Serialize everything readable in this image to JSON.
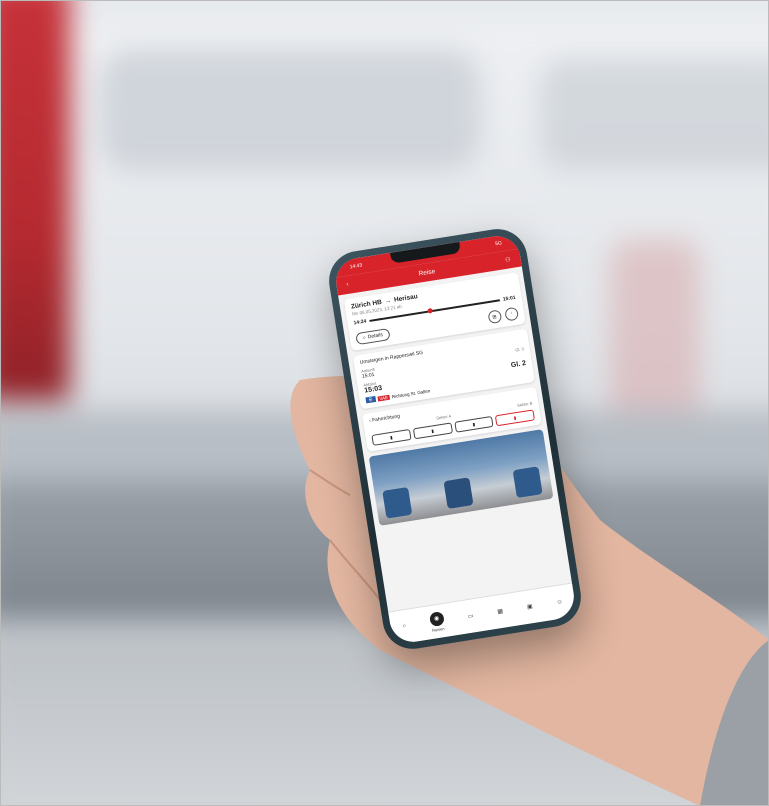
{
  "status": {
    "time": "14:43",
    "signal": "5G"
  },
  "header": {
    "back_icon": "chevron-left-icon",
    "title": "Reise",
    "share_icon": "people-icon"
  },
  "trip": {
    "route_from": "Zürich HB",
    "route_to": "Herisau",
    "date": "Mo 06.05.2023, 13:21 ab",
    "dep": "14:24",
    "arr": "15:01",
    "details_label": "Details"
  },
  "transfer": {
    "title": "Umsteigen in Rapperswil SG",
    "arrival_label": "Ankunft",
    "arrival_time": "15:01",
    "arrival_track": "Gl. 3",
    "departure_label": "Abfahrt",
    "departure_time": "15:03",
    "departure_track": "Gl. 2",
    "direction": "Richtung St. Gallen",
    "badge_line": "VAE"
  },
  "formation": {
    "title": "Fahrrichtung",
    "sector_a": "Sektor A",
    "sector_b": "Sektor B"
  },
  "tabs": [
    {
      "icon": "search-icon",
      "label": ""
    },
    {
      "icon": "journey-icon",
      "label": "Reisen"
    },
    {
      "icon": "ticket-icon",
      "label": ""
    },
    {
      "icon": "qr-icon",
      "label": ""
    },
    {
      "icon": "card-icon",
      "label": ""
    },
    {
      "icon": "profile-icon",
      "label": ""
    }
  ],
  "colors": {
    "brand": "#d8232a"
  }
}
